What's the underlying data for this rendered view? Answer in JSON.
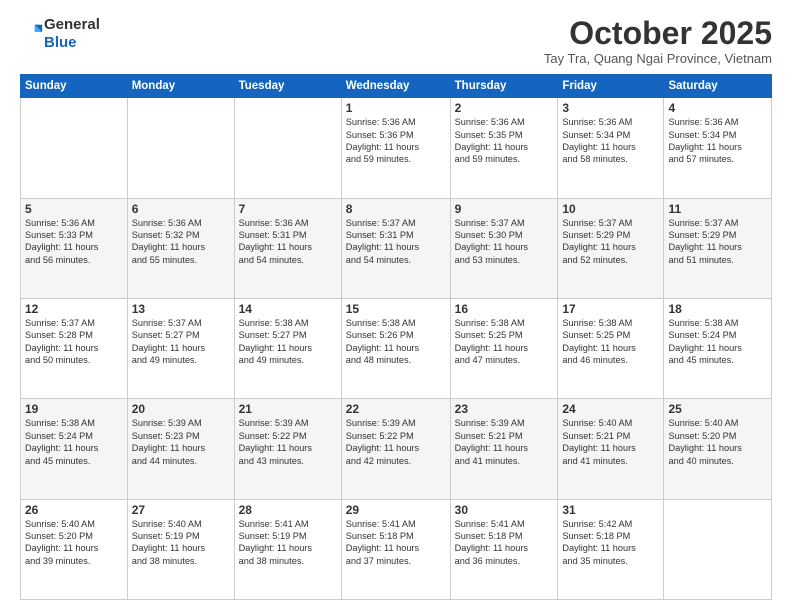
{
  "logo": {
    "general": "General",
    "blue": "Blue"
  },
  "header": {
    "month": "October 2025",
    "location": "Tay Tra, Quang Ngai Province, Vietnam"
  },
  "weekdays": [
    "Sunday",
    "Monday",
    "Tuesday",
    "Wednesday",
    "Thursday",
    "Friday",
    "Saturday"
  ],
  "weeks": [
    [
      {
        "day": "",
        "info": ""
      },
      {
        "day": "",
        "info": ""
      },
      {
        "day": "",
        "info": ""
      },
      {
        "day": "1",
        "info": "Sunrise: 5:36 AM\nSunset: 5:36 PM\nDaylight: 11 hours\nand 59 minutes."
      },
      {
        "day": "2",
        "info": "Sunrise: 5:36 AM\nSunset: 5:35 PM\nDaylight: 11 hours\nand 59 minutes."
      },
      {
        "day": "3",
        "info": "Sunrise: 5:36 AM\nSunset: 5:34 PM\nDaylight: 11 hours\nand 58 minutes."
      },
      {
        "day": "4",
        "info": "Sunrise: 5:36 AM\nSunset: 5:34 PM\nDaylight: 11 hours\nand 57 minutes."
      }
    ],
    [
      {
        "day": "5",
        "info": "Sunrise: 5:36 AM\nSunset: 5:33 PM\nDaylight: 11 hours\nand 56 minutes."
      },
      {
        "day": "6",
        "info": "Sunrise: 5:36 AM\nSunset: 5:32 PM\nDaylight: 11 hours\nand 55 minutes."
      },
      {
        "day": "7",
        "info": "Sunrise: 5:36 AM\nSunset: 5:31 PM\nDaylight: 11 hours\nand 54 minutes."
      },
      {
        "day": "8",
        "info": "Sunrise: 5:37 AM\nSunset: 5:31 PM\nDaylight: 11 hours\nand 54 minutes."
      },
      {
        "day": "9",
        "info": "Sunrise: 5:37 AM\nSunset: 5:30 PM\nDaylight: 11 hours\nand 53 minutes."
      },
      {
        "day": "10",
        "info": "Sunrise: 5:37 AM\nSunset: 5:29 PM\nDaylight: 11 hours\nand 52 minutes."
      },
      {
        "day": "11",
        "info": "Sunrise: 5:37 AM\nSunset: 5:29 PM\nDaylight: 11 hours\nand 51 minutes."
      }
    ],
    [
      {
        "day": "12",
        "info": "Sunrise: 5:37 AM\nSunset: 5:28 PM\nDaylight: 11 hours\nand 50 minutes."
      },
      {
        "day": "13",
        "info": "Sunrise: 5:37 AM\nSunset: 5:27 PM\nDaylight: 11 hours\nand 49 minutes."
      },
      {
        "day": "14",
        "info": "Sunrise: 5:38 AM\nSunset: 5:27 PM\nDaylight: 11 hours\nand 49 minutes."
      },
      {
        "day": "15",
        "info": "Sunrise: 5:38 AM\nSunset: 5:26 PM\nDaylight: 11 hours\nand 48 minutes."
      },
      {
        "day": "16",
        "info": "Sunrise: 5:38 AM\nSunset: 5:25 PM\nDaylight: 11 hours\nand 47 minutes."
      },
      {
        "day": "17",
        "info": "Sunrise: 5:38 AM\nSunset: 5:25 PM\nDaylight: 11 hours\nand 46 minutes."
      },
      {
        "day": "18",
        "info": "Sunrise: 5:38 AM\nSunset: 5:24 PM\nDaylight: 11 hours\nand 45 minutes."
      }
    ],
    [
      {
        "day": "19",
        "info": "Sunrise: 5:38 AM\nSunset: 5:24 PM\nDaylight: 11 hours\nand 45 minutes."
      },
      {
        "day": "20",
        "info": "Sunrise: 5:39 AM\nSunset: 5:23 PM\nDaylight: 11 hours\nand 44 minutes."
      },
      {
        "day": "21",
        "info": "Sunrise: 5:39 AM\nSunset: 5:22 PM\nDaylight: 11 hours\nand 43 minutes."
      },
      {
        "day": "22",
        "info": "Sunrise: 5:39 AM\nSunset: 5:22 PM\nDaylight: 11 hours\nand 42 minutes."
      },
      {
        "day": "23",
        "info": "Sunrise: 5:39 AM\nSunset: 5:21 PM\nDaylight: 11 hours\nand 41 minutes."
      },
      {
        "day": "24",
        "info": "Sunrise: 5:40 AM\nSunset: 5:21 PM\nDaylight: 11 hours\nand 41 minutes."
      },
      {
        "day": "25",
        "info": "Sunrise: 5:40 AM\nSunset: 5:20 PM\nDaylight: 11 hours\nand 40 minutes."
      }
    ],
    [
      {
        "day": "26",
        "info": "Sunrise: 5:40 AM\nSunset: 5:20 PM\nDaylight: 11 hours\nand 39 minutes."
      },
      {
        "day": "27",
        "info": "Sunrise: 5:40 AM\nSunset: 5:19 PM\nDaylight: 11 hours\nand 38 minutes."
      },
      {
        "day": "28",
        "info": "Sunrise: 5:41 AM\nSunset: 5:19 PM\nDaylight: 11 hours\nand 38 minutes."
      },
      {
        "day": "29",
        "info": "Sunrise: 5:41 AM\nSunset: 5:18 PM\nDaylight: 11 hours\nand 37 minutes."
      },
      {
        "day": "30",
        "info": "Sunrise: 5:41 AM\nSunset: 5:18 PM\nDaylight: 11 hours\nand 36 minutes."
      },
      {
        "day": "31",
        "info": "Sunrise: 5:42 AM\nSunset: 5:18 PM\nDaylight: 11 hours\nand 35 minutes."
      },
      {
        "day": "",
        "info": ""
      }
    ]
  ]
}
